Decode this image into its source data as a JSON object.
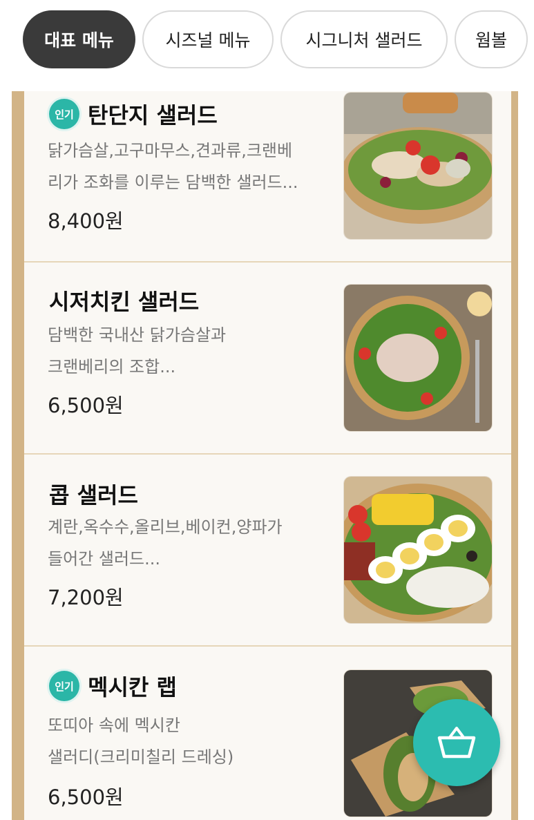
{
  "tabs": [
    {
      "label": "대표 메뉴",
      "active": true
    },
    {
      "label": "시즈널 메뉴",
      "active": false
    },
    {
      "label": "시그니처 샐러드",
      "active": false
    },
    {
      "label": "웜볼",
      "active": false
    }
  ],
  "items": [
    {
      "badge": "인기",
      "name": "탄단지 샐러드",
      "desc_line1": "닭가슴살,고구마무스,견과류,크랜베",
      "desc_line2": "리가 조화를 이루는 담백한 샐러드...",
      "price": "8,400원"
    },
    {
      "badge": "",
      "name": "시저치킨 샐러드",
      "desc_line1": "담백한 국내산 닭가슴살과",
      "desc_line2": "크랜베리의 조합...",
      "price": "6,500원"
    },
    {
      "badge": "",
      "name": "콥 샐러드",
      "desc_line1": "계란,옥수수,올리브,베이컨,양파가",
      "desc_line2": "들어간 샐러드...",
      "price": "7,200원"
    },
    {
      "badge": "인기",
      "name": "멕시칸 랩",
      "desc_line1": "또띠아 속에 멕시칸",
      "desc_line2": "샐러디(크리미칠리 드레싱)",
      "price": "6,500원"
    }
  ],
  "colors": {
    "accent": "#2cbcb0",
    "active_tab": "#3a3a3a",
    "frame": "#d2b487"
  },
  "icons": {
    "cart": "basket-icon"
  }
}
